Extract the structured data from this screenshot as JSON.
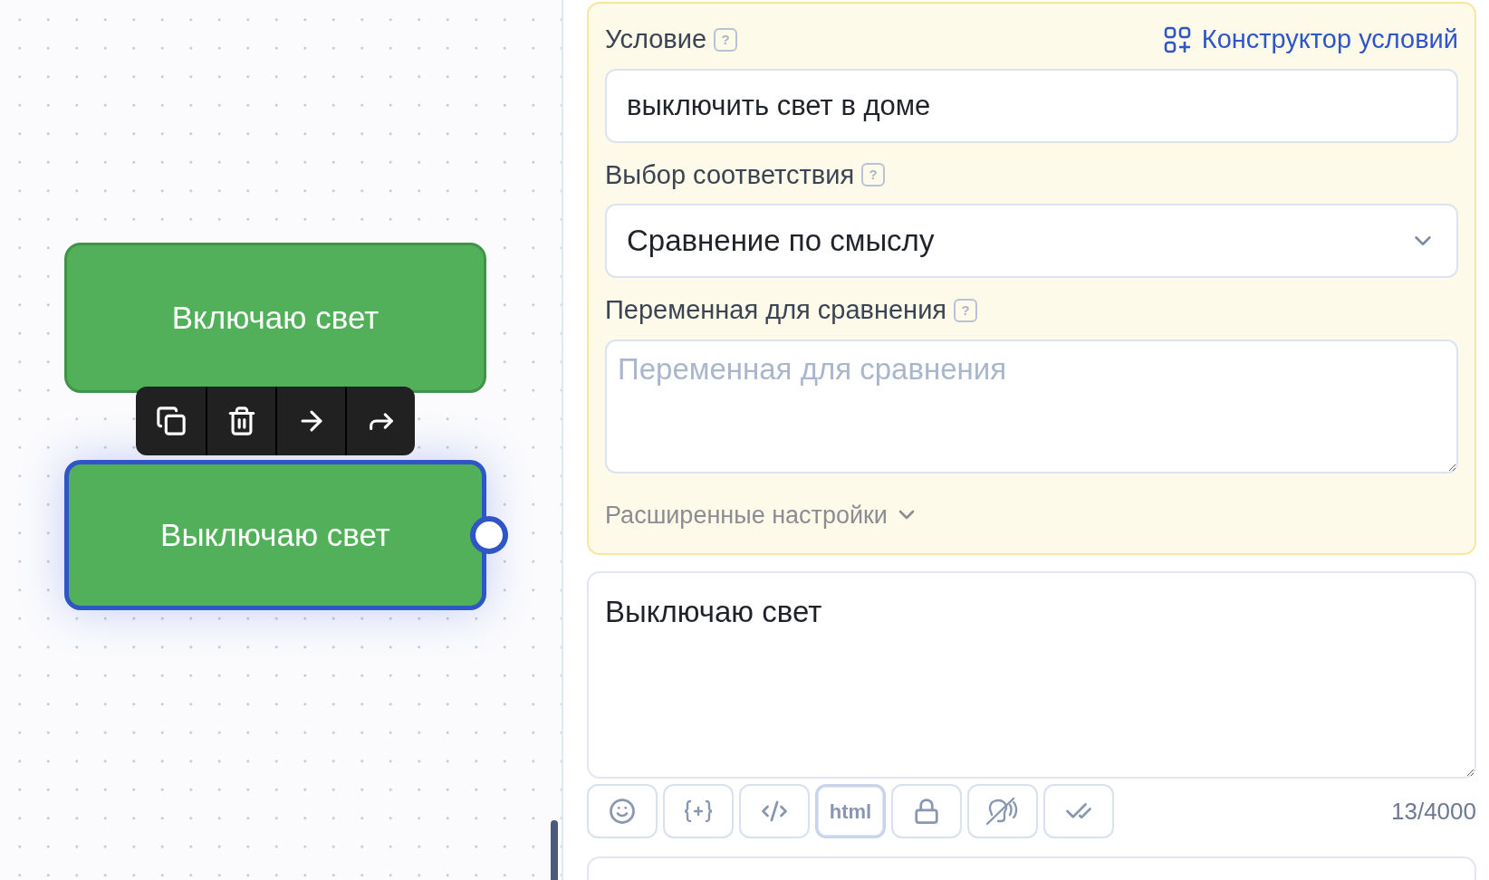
{
  "canvas": {
    "nodes": [
      {
        "label": "Включаю свет",
        "selected": false
      },
      {
        "label": "Выключаю свет",
        "selected": true
      }
    ],
    "node_toolbar": [
      {
        "kind": "copy"
      },
      {
        "kind": "delete"
      },
      {
        "kind": "arrow"
      },
      {
        "kind": "forward"
      }
    ]
  },
  "condition_card": {
    "condition": {
      "label": "Условие",
      "help": "?",
      "link": "Конструктор условий",
      "value": "выключить свет в доме"
    },
    "match": {
      "label": "Выбор соответствия",
      "help": "?",
      "value": "Сравнение по смыслу"
    },
    "variable": {
      "label": "Переменная для сравнения",
      "help": "?",
      "placeholder": "Переменная для сравнения"
    },
    "advanced": {
      "label": "Расширенные настройки",
      "expanded": false
    }
  },
  "message": {
    "value": "Выключаю свет"
  },
  "message_toolbar": [
    {
      "kind": "emoji",
      "selected": false
    },
    {
      "kind": "variable",
      "selected": false
    },
    {
      "kind": "code",
      "selected": false
    },
    {
      "kind": "html",
      "label": "html",
      "selected": true
    },
    {
      "kind": "lock",
      "selected": false
    },
    {
      "kind": "mute",
      "selected": false
    },
    {
      "kind": "check",
      "selected": false
    }
  ],
  "counter": "13/4000"
}
